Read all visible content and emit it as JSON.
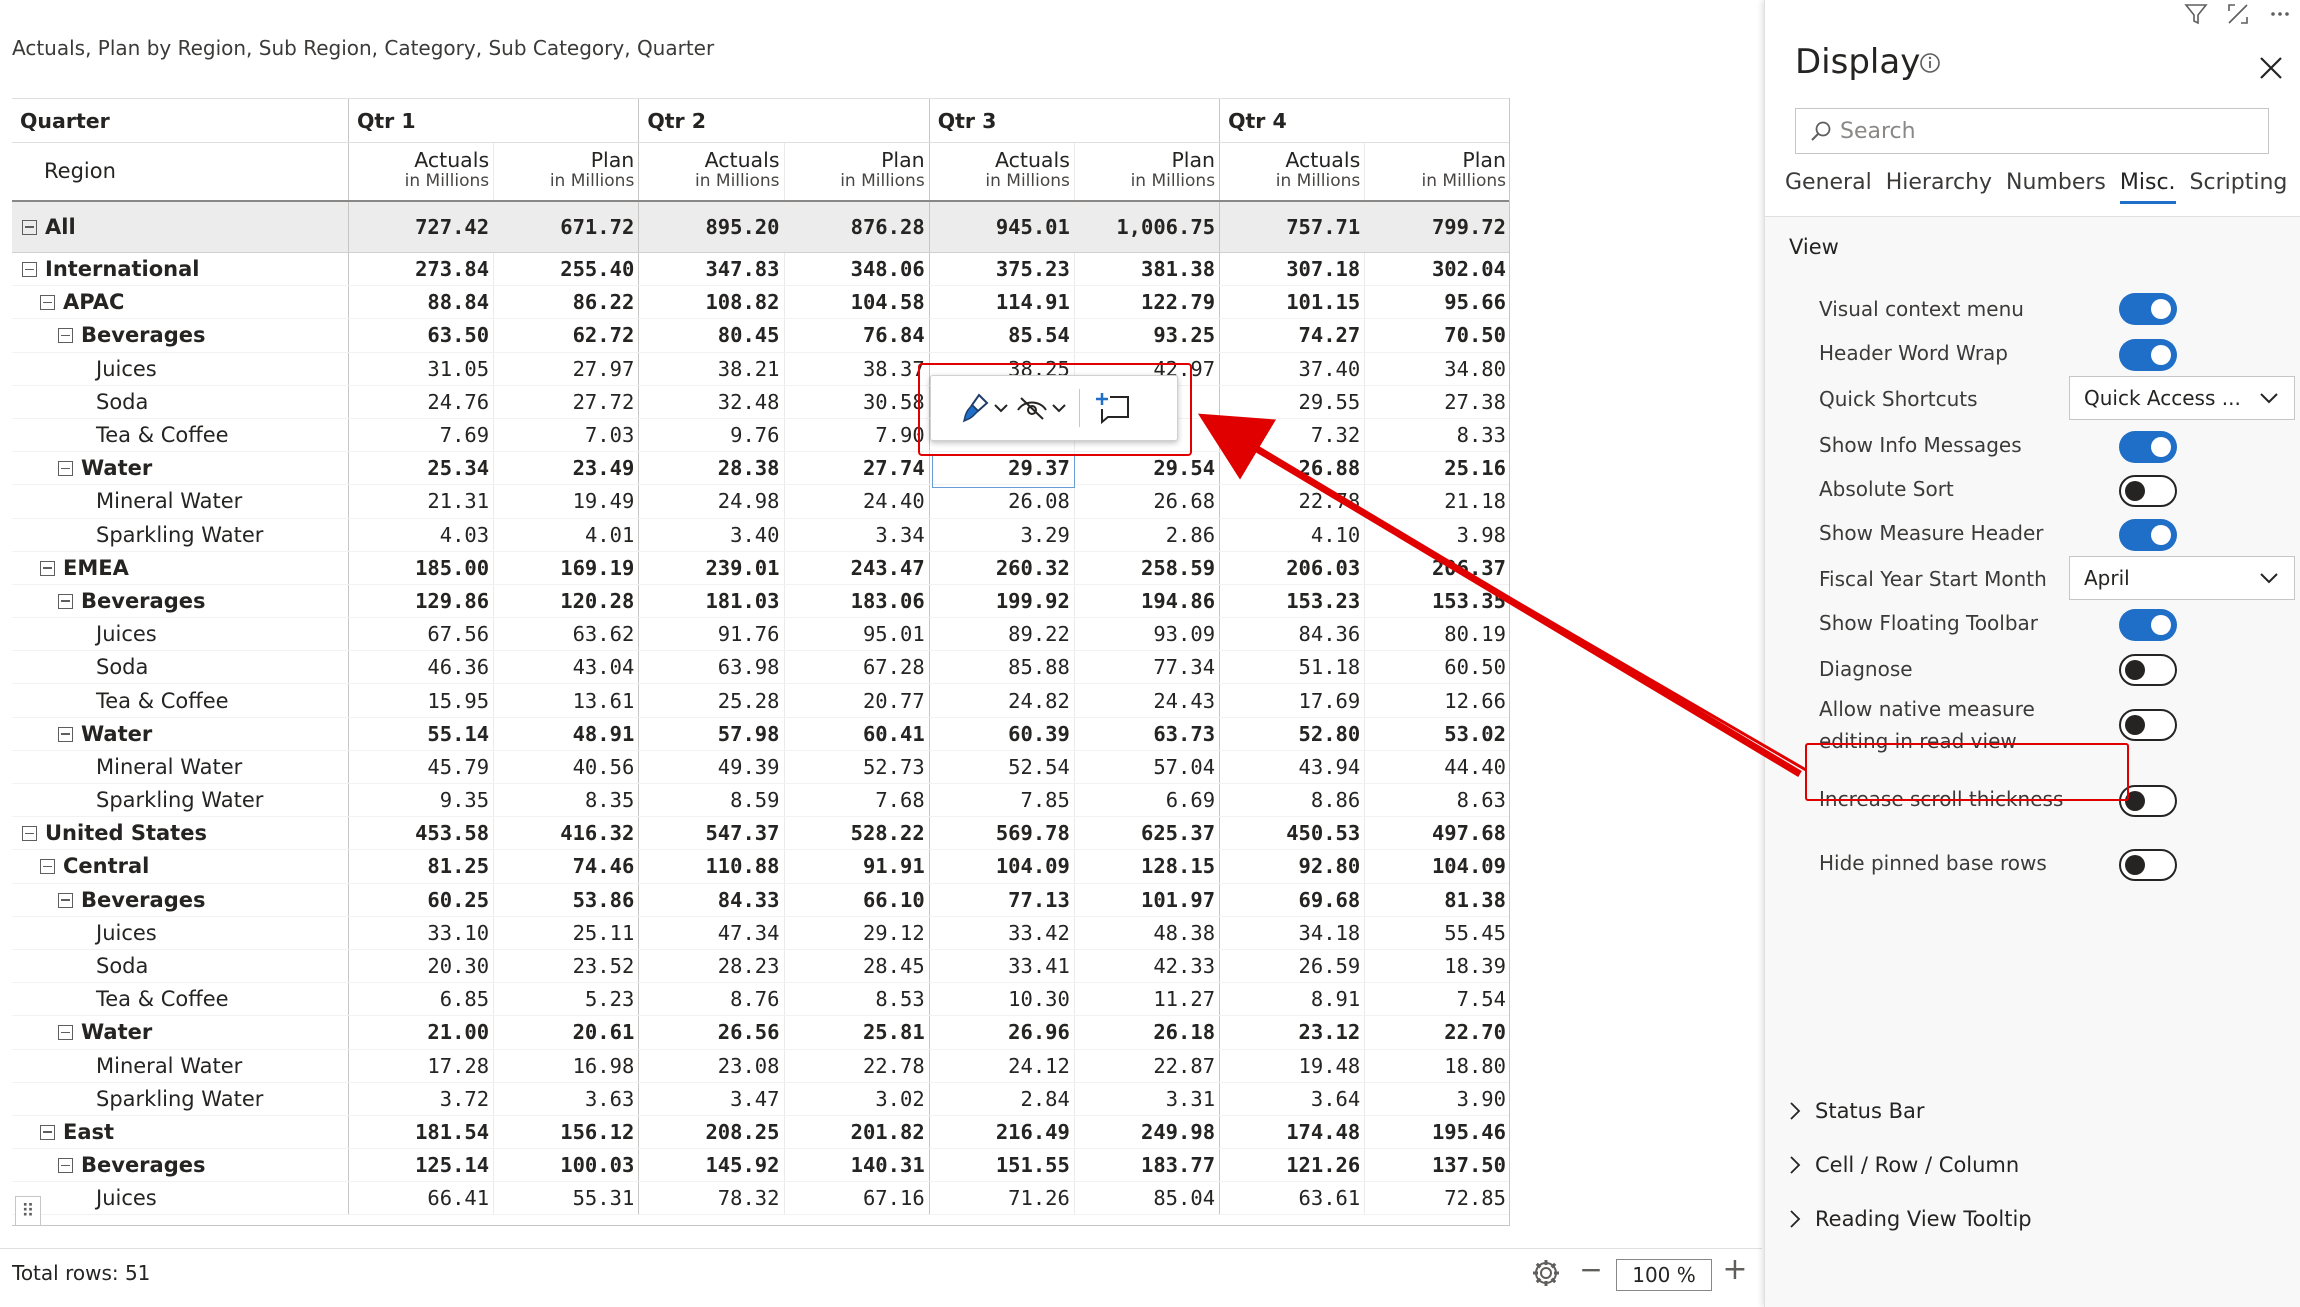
{
  "visual_title": "Actuals, Plan by Region, Sub Region, Category, Sub Category, Quarter",
  "matrix": {
    "corner_label": "Quarter",
    "row_header_label": "Region",
    "quarters": [
      "Qtr 1",
      "Qtr 2",
      "Qtr 3",
      "Qtr 4"
    ],
    "measures": [
      {
        "name": "Actuals",
        "unit": "in Millions"
      },
      {
        "name": "Plan",
        "unit": "in Millions"
      }
    ],
    "rows": [
      {
        "label": "All",
        "level": 0,
        "toggle": true,
        "bold": true,
        "total": true,
        "values": [
          "727.42",
          "671.72",
          "895.20",
          "876.28",
          "945.01",
          "1,006.75",
          "757.71",
          "799.72"
        ]
      },
      {
        "label": "International",
        "level": 0,
        "toggle": true,
        "bold": true,
        "values": [
          "273.84",
          "255.40",
          "347.83",
          "348.06",
          "375.23",
          "381.38",
          "307.18",
          "302.04"
        ]
      },
      {
        "label": "APAC",
        "level": 1,
        "toggle": true,
        "bold": true,
        "values": [
          "88.84",
          "86.22",
          "108.82",
          "104.58",
          "114.91",
          "122.79",
          "101.15",
          "95.66"
        ]
      },
      {
        "label": "Beverages",
        "level": 2,
        "toggle": true,
        "bold": true,
        "values": [
          "63.50",
          "62.72",
          "80.45",
          "76.84",
          "85.54",
          "93.25",
          "74.27",
          "70.50"
        ]
      },
      {
        "label": "Juices",
        "level": 3,
        "values": [
          "31.05",
          "27.97",
          "38.21",
          "38.37",
          "38.25",
          "42.97",
          "37.40",
          "34.80"
        ]
      },
      {
        "label": "Soda",
        "level": 3,
        "values": [
          "24.76",
          "27.72",
          "32.48",
          "30.58",
          "",
          "",
          "29.55",
          "27.38"
        ]
      },
      {
        "label": "Tea & Coffee",
        "level": 3,
        "values": [
          "7.69",
          "7.03",
          "9.76",
          "7.90",
          "",
          "",
          "7.32",
          "8.33"
        ]
      },
      {
        "label": "Water",
        "level": 2,
        "toggle": true,
        "bold": true,
        "values": [
          "25.34",
          "23.49",
          "28.38",
          "27.74",
          "29.37",
          "29.54",
          "26.88",
          "25.16"
        ]
      },
      {
        "label": "Mineral Water",
        "level": 3,
        "values": [
          "21.31",
          "19.49",
          "24.98",
          "24.40",
          "26.08",
          "26.68",
          "22.78",
          "21.18"
        ]
      },
      {
        "label": "Sparkling Water",
        "level": 3,
        "values": [
          "4.03",
          "4.01",
          "3.40",
          "3.34",
          "3.29",
          "2.86",
          "4.10",
          "3.98"
        ]
      },
      {
        "label": "EMEA",
        "level": 1,
        "toggle": true,
        "bold": true,
        "values": [
          "185.00",
          "169.19",
          "239.01",
          "243.47",
          "260.32",
          "258.59",
          "206.03",
          "206.37"
        ]
      },
      {
        "label": "Beverages",
        "level": 2,
        "toggle": true,
        "bold": true,
        "values": [
          "129.86",
          "120.28",
          "181.03",
          "183.06",
          "199.92",
          "194.86",
          "153.23",
          "153.35"
        ]
      },
      {
        "label": "Juices",
        "level": 3,
        "values": [
          "67.56",
          "63.62",
          "91.76",
          "95.01",
          "89.22",
          "93.09",
          "84.36",
          "80.19"
        ]
      },
      {
        "label": "Soda",
        "level": 3,
        "values": [
          "46.36",
          "43.04",
          "63.98",
          "67.28",
          "85.88",
          "77.34",
          "51.18",
          "60.50"
        ]
      },
      {
        "label": "Tea & Coffee",
        "level": 3,
        "values": [
          "15.95",
          "13.61",
          "25.28",
          "20.77",
          "24.82",
          "24.43",
          "17.69",
          "12.66"
        ]
      },
      {
        "label": "Water",
        "level": 2,
        "toggle": true,
        "bold": true,
        "values": [
          "55.14",
          "48.91",
          "57.98",
          "60.41",
          "60.39",
          "63.73",
          "52.80",
          "53.02"
        ]
      },
      {
        "label": "Mineral Water",
        "level": 3,
        "values": [
          "45.79",
          "40.56",
          "49.39",
          "52.73",
          "52.54",
          "57.04",
          "43.94",
          "44.40"
        ]
      },
      {
        "label": "Sparkling Water",
        "level": 3,
        "values": [
          "9.35",
          "8.35",
          "8.59",
          "7.68",
          "7.85",
          "6.69",
          "8.86",
          "8.63"
        ]
      },
      {
        "label": "United States",
        "level": 0,
        "toggle": true,
        "bold": true,
        "values": [
          "453.58",
          "416.32",
          "547.37",
          "528.22",
          "569.78",
          "625.37",
          "450.53",
          "497.68"
        ]
      },
      {
        "label": "Central",
        "level": 1,
        "toggle": true,
        "bold": true,
        "values": [
          "81.25",
          "74.46",
          "110.88",
          "91.91",
          "104.09",
          "128.15",
          "92.80",
          "104.09"
        ]
      },
      {
        "label": "Beverages",
        "level": 2,
        "toggle": true,
        "bold": true,
        "values": [
          "60.25",
          "53.86",
          "84.33",
          "66.10",
          "77.13",
          "101.97",
          "69.68",
          "81.38"
        ]
      },
      {
        "label": "Juices",
        "level": 3,
        "values": [
          "33.10",
          "25.11",
          "47.34",
          "29.12",
          "33.42",
          "48.38",
          "34.18",
          "55.45"
        ]
      },
      {
        "label": "Soda",
        "level": 3,
        "values": [
          "20.30",
          "23.52",
          "28.23",
          "28.45",
          "33.41",
          "42.33",
          "26.59",
          "18.39"
        ]
      },
      {
        "label": "Tea & Coffee",
        "level": 3,
        "values": [
          "6.85",
          "5.23",
          "8.76",
          "8.53",
          "10.30",
          "11.27",
          "8.91",
          "7.54"
        ]
      },
      {
        "label": "Water",
        "level": 2,
        "toggle": true,
        "bold": true,
        "values": [
          "21.00",
          "20.61",
          "26.56",
          "25.81",
          "26.96",
          "26.18",
          "23.12",
          "22.70"
        ]
      },
      {
        "label": "Mineral Water",
        "level": 3,
        "values": [
          "17.28",
          "16.98",
          "23.08",
          "22.78",
          "24.12",
          "22.87",
          "19.48",
          "18.80"
        ]
      },
      {
        "label": "Sparkling Water",
        "level": 3,
        "values": [
          "3.72",
          "3.63",
          "3.47",
          "3.02",
          "2.84",
          "3.31",
          "3.64",
          "3.90"
        ]
      },
      {
        "label": "East",
        "level": 1,
        "toggle": true,
        "bold": true,
        "values": [
          "181.54",
          "156.12",
          "208.25",
          "201.82",
          "216.49",
          "249.98",
          "174.48",
          "195.46"
        ]
      },
      {
        "label": "Beverages",
        "level": 2,
        "toggle": true,
        "bold": true,
        "values": [
          "125.14",
          "100.03",
          "145.92",
          "140.31",
          "151.55",
          "183.77",
          "121.26",
          "137.50"
        ]
      },
      {
        "label": "Juices",
        "level": 3,
        "values": [
          "66.41",
          "55.31",
          "78.32",
          "67.16",
          "71.26",
          "85.04",
          "63.61",
          "72.85"
        ]
      }
    ]
  },
  "floating_toolbar": {
    "icons": [
      "paint-brush-icon",
      "hide-eye-icon",
      "add-comment-icon"
    ]
  },
  "status_bar": {
    "total_rows": "Total rows: 51",
    "zoom_value": "100 %",
    "zoom_minus": "−",
    "zoom_plus": "+"
  },
  "pane": {
    "title": "Display",
    "search_placeholder": "Search",
    "tabs": [
      "General",
      "Hierarchy",
      "Numbers",
      "Misc.",
      "Scripting"
    ],
    "active_tab": "Misc.",
    "section_title": "View",
    "settings": [
      {
        "label": "Visual context menu",
        "type": "toggle",
        "on": true
      },
      {
        "label": "Header Word Wrap",
        "type": "toggle",
        "on": true
      },
      {
        "label": "Quick Shortcuts",
        "type": "dropdown",
        "value": "Quick Access ..."
      },
      {
        "label": "Show Info Messages",
        "type": "toggle",
        "on": true
      },
      {
        "label": "Absolute Sort",
        "type": "toggle",
        "on": false
      },
      {
        "label": "Show Measure Header",
        "type": "toggle",
        "on": true
      },
      {
        "label": "Fiscal Year Start Month",
        "type": "dropdown",
        "value": "April"
      },
      {
        "label": "Show Floating Toolbar",
        "type": "toggle",
        "on": true
      },
      {
        "label": "Diagnose",
        "type": "toggle",
        "on": false
      },
      {
        "label": "Allow native measure editing in read view",
        "type": "toggle",
        "on": false
      },
      {
        "label": "Increase scroll thickness",
        "type": "toggle",
        "on": false
      },
      {
        "label": "Hide pinned base rows",
        "type": "toggle",
        "on": false
      }
    ],
    "collapsed_sections": [
      "Status Bar",
      "Cell / Row / Column",
      "Reading View Tooltip"
    ]
  },
  "colors": {
    "accent": "#1f6ec8",
    "highlight": "#e00000"
  }
}
